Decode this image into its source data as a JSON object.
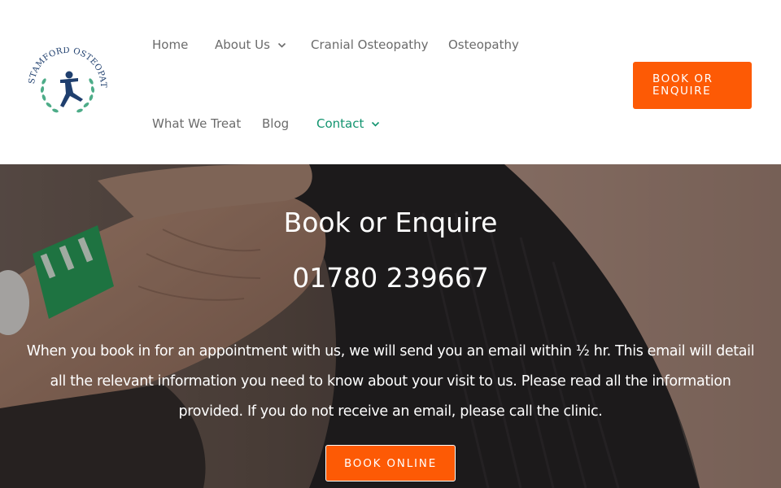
{
  "logo": {
    "text": "STAMFORD OSTEOPATHIC CLINIC",
    "icon": "leaping-figure-wreath-logo"
  },
  "nav": {
    "home": "Home",
    "about": "About Us",
    "cranial": "Cranial Osteopathy",
    "osteopathy": "Osteopathy",
    "what_we_treat": "What We Treat",
    "blog": "Blog",
    "contact": "Contact",
    "cta": "BOOK OR ENQUIRE"
  },
  "hero": {
    "title": "Book or Enquire",
    "phone": "01780 239667",
    "text": "When you book in for an appointment with us, we will send you an email within ½ hr. This email will detail all the relevant information you need to know about your visit to us. Please read all the information provided. If you do not receive an email, please call the clinic.",
    "button": "BOOK ONLINE"
  },
  "colors": {
    "accent": "#fd5a05",
    "active_nav": "#12946f",
    "nav_text": "#6b6b6b",
    "logo_blue": "#1f3f6e",
    "logo_green": "#2e9e74"
  }
}
